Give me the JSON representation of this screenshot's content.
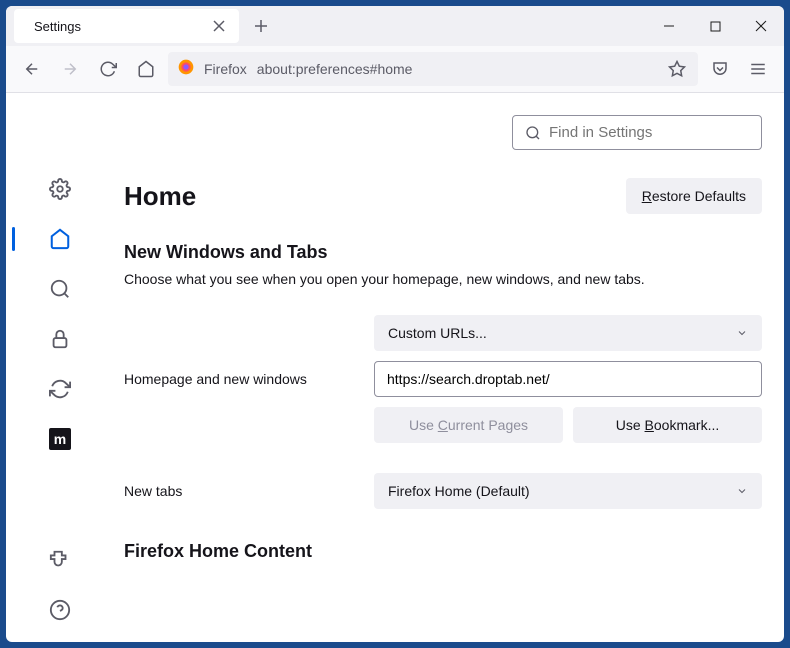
{
  "tab": {
    "title": "Settings"
  },
  "addressbar": {
    "label": "Firefox",
    "url": "about:preferences#home"
  },
  "search": {
    "placeholder": "Find in Settings"
  },
  "page": {
    "title": "Home",
    "restore_btn": "Restore Defaults"
  },
  "section": {
    "title": "New Windows and Tabs",
    "desc": "Choose what you see when you open your homepage, new windows, and new tabs."
  },
  "homepage": {
    "label": "Homepage and new windows",
    "select": "Custom URLs...",
    "url_value": "https://search.droptab.net/",
    "btn_current": "Use Current Pages",
    "btn_bookmark": "Use Bookmark..."
  },
  "newtabs": {
    "label": "New tabs",
    "select": "Firefox Home (Default)"
  },
  "section2": {
    "title": "Firefox Home Content"
  },
  "ext_icon": "m"
}
